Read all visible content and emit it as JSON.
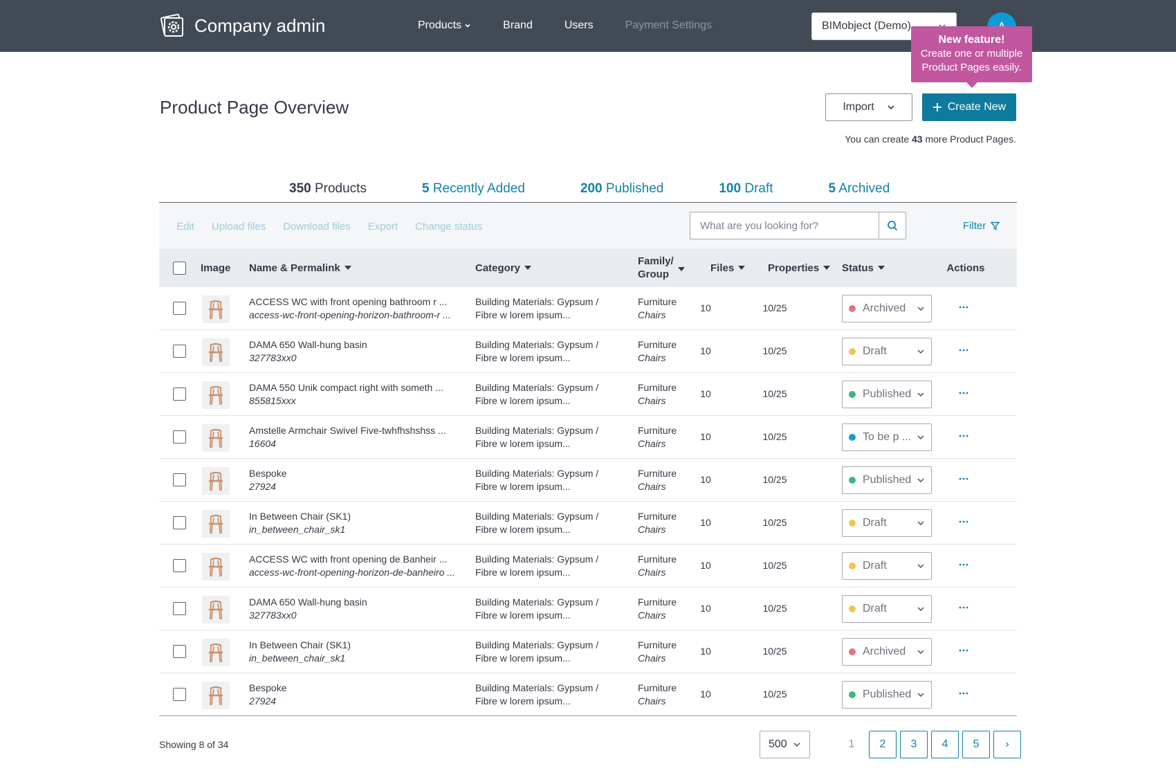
{
  "header": {
    "app_title": "Company admin",
    "nav": [
      {
        "label": "Products",
        "has_dropdown": true
      },
      {
        "label": "Brand"
      },
      {
        "label": "Users"
      },
      {
        "label": "Payment Settings",
        "disabled": true
      }
    ],
    "company_select": "BIMobject (Demo)",
    "avatar_initial": "A"
  },
  "tooltip": {
    "title": "New feature!",
    "line1": "Create one or multiple",
    "line2": "Product Pages easily."
  },
  "page": {
    "title": "Product Page Overview",
    "import_label": "Import",
    "create_label": "Create New",
    "quota_prefix": "You can create ",
    "quota_count": "43",
    "quota_suffix": " more Product Pages."
  },
  "summary_tabs": [
    {
      "count": "350",
      "label": "Products",
      "active": true
    },
    {
      "count": "5",
      "label": "Recently Added"
    },
    {
      "count": "200",
      "label": "Published"
    },
    {
      "count": "100",
      "label": "Draft"
    },
    {
      "count": "5",
      "label": "Archived"
    }
  ],
  "toolbar": {
    "actions": [
      "Edit",
      "Upload files",
      "Download files",
      "Export",
      "Change status"
    ],
    "search_placeholder": "What are you looking for?",
    "filter_label": "Filter"
  },
  "table": {
    "headers": {
      "image": "Image",
      "name": "Name & Permalink",
      "category": "Category",
      "family_line1": "Family/",
      "family_line2": "Group",
      "files": "Files",
      "properties": "Properties",
      "status": "Status",
      "actions": "Actions"
    },
    "status_colors": {
      "Archived": "#e8707f",
      "Draft": "#f3c54f",
      "Published": "#3fb67f",
      "To be p ...": "#1a9ad6"
    },
    "rows": [
      {
        "name": "ACCESS WC with front opening bathroom r ...",
        "permalink": "access-wc-front-opening-horizon-bathroom-r ...",
        "category_line1": "Building Materials: Gypsum /",
        "category_line2": "Fibre w lorem ipsum...",
        "family": "Furniture",
        "group": "Chairs",
        "files": "10",
        "properties": "10/25",
        "status": "Archived"
      },
      {
        "name": "DAMA 650 Wall-hung basin",
        "permalink": "327783xx0",
        "category_line1": "Building Materials: Gypsum /",
        "category_line2": "Fibre w lorem ipsum...",
        "family": "Furniture",
        "group": "Chairs",
        "files": "10",
        "properties": "10/25",
        "status": "Draft"
      },
      {
        "name": "DAMA 550 Unik compact right with someth ...",
        "permalink": "855815xxx",
        "category_line1": "Building Materials: Gypsum /",
        "category_line2": "Fibre w lorem ipsum...",
        "family": "Furniture",
        "group": "Chairs",
        "files": "10",
        "properties": "10/25",
        "status": "Published"
      },
      {
        "name": "Amstelle Armchair Swivel Five-twhfhshshss ...",
        "permalink": "16604",
        "category_line1": "Building Materials: Gypsum /",
        "category_line2": "Fibre w lorem ipsum...",
        "family": "Furniture",
        "group": "Chairs",
        "files": "10",
        "properties": "10/25",
        "status": "To be p ..."
      },
      {
        "name": "Bespoke",
        "permalink": "27924",
        "category_line1": "Building Materials: Gypsum /",
        "category_line2": "Fibre w lorem ipsum...",
        "family": "Furniture",
        "group": "Chairs",
        "files": "10",
        "properties": "10/25",
        "status": "Published"
      },
      {
        "name": "In Between Chair (SK1)",
        "permalink": "in_between_chair_sk1",
        "category_line1": "Building Materials: Gypsum /",
        "category_line2": "Fibre w lorem ipsum...",
        "family": "Furniture",
        "group": "Chairs",
        "files": "10",
        "properties": "10/25",
        "status": "Draft"
      },
      {
        "name": "ACCESS WC with front opening de Banheir ...",
        "permalink": "access-wc-front-opening-horizon-de-banheiro ...",
        "category_line1": "Building Materials: Gypsum /",
        "category_line2": "Fibre w lorem ipsum...",
        "family": "Furniture",
        "group": "Chairs",
        "files": "10",
        "properties": "10/25",
        "status": "Draft"
      },
      {
        "name": "DAMA 650 Wall-hung basin",
        "permalink": "327783xx0",
        "category_line1": "Building Materials: Gypsum /",
        "category_line2": "Fibre w lorem ipsum...",
        "family": "Furniture",
        "group": "Chairs",
        "files": "10",
        "properties": "10/25",
        "status": "Draft"
      },
      {
        "name": "In Between Chair (SK1)",
        "permalink": "in_between_chair_sk1",
        "category_line1": "Building Materials: Gypsum /",
        "category_line2": "Fibre w lorem ipsum...",
        "family": "Furniture",
        "group": "Chairs",
        "files": "10",
        "properties": "10/25",
        "status": "Archived"
      },
      {
        "name": "Bespoke",
        "permalink": "27924",
        "category_line1": "Building Materials: Gypsum /",
        "category_line2": "Fibre w lorem ipsum...",
        "family": "Furniture",
        "group": "Chairs",
        "files": "10",
        "properties": "10/25",
        "status": "Published"
      }
    ]
  },
  "footer": {
    "showing": "Showing 8 of 34",
    "per_page": "500",
    "pages": [
      "1",
      "2",
      "3",
      "4",
      "5"
    ],
    "current_page": "1",
    "next_label": "›"
  },
  "colors": {
    "topbar": "#424a56",
    "accent": "#0f7a9c",
    "link": "#1481a7",
    "tooltip": "#c1579f"
  }
}
